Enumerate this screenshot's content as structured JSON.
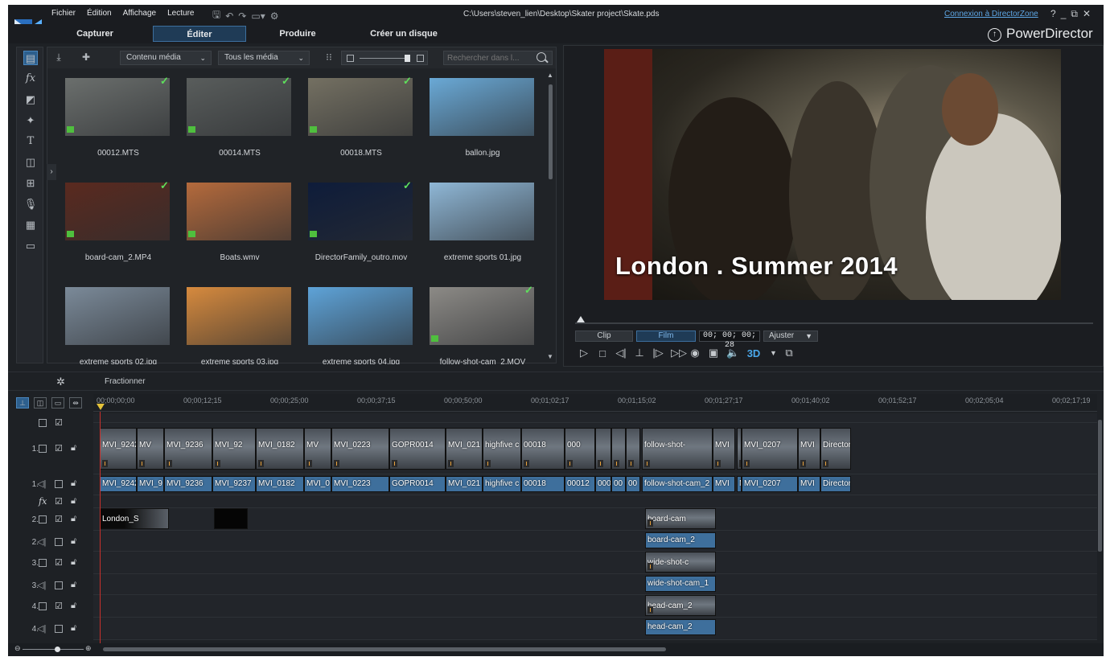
{
  "menu": [
    "Fichier",
    "Édition",
    "Affichage",
    "Lecture"
  ],
  "window": {
    "path": "C:\\Users\\steven_lien\\Desktop\\Skater project\\Skate.pds",
    "directorzone": "Connexion à DirectorZone",
    "brand": "PowerDirector"
  },
  "modes": [
    "Capturer",
    "Éditer",
    "Produire",
    "Créer un disque"
  ],
  "library": {
    "filter1": "Contenu média",
    "filter2": "Tous les média",
    "search_placeholder": "Rechercher dans l...",
    "items": [
      {
        "name": "00012.MTS",
        "checked": true,
        "video": true,
        "color": "#6b6f6d"
      },
      {
        "name": "00014.MTS",
        "checked": true,
        "video": true,
        "color": "#595d5c"
      },
      {
        "name": "00018.MTS",
        "checked": true,
        "video": true,
        "color": "#747062"
      },
      {
        "name": "ballon.jpg",
        "checked": false,
        "video": false,
        "color": "#6aa9d6"
      },
      {
        "name": "board-cam_2.MP4",
        "checked": true,
        "video": true,
        "color": "#5a2a1f"
      },
      {
        "name": "Boats.wmv",
        "checked": false,
        "video": true,
        "color": "#b46a3c"
      },
      {
        "name": "DirectorFamily_outro.mov",
        "checked": true,
        "video": true,
        "color": "#0e1c3a"
      },
      {
        "name": "extreme sports 01.jpg",
        "checked": false,
        "video": false,
        "color": "#8fb7d6"
      },
      {
        "name": "extreme sports 02.jpg",
        "checked": false,
        "video": false,
        "color": "#7b8a99"
      },
      {
        "name": "extreme sports 03.jpg",
        "checked": false,
        "video": false,
        "color": "#d68a3e"
      },
      {
        "name": "extreme sports 04.jpg",
        "checked": false,
        "video": false,
        "color": "#5ea3d8"
      },
      {
        "name": "follow-shot-cam_2.MOV",
        "checked": true,
        "video": true,
        "color": "#8c8a86"
      }
    ]
  },
  "preview": {
    "caption": "London . Summer 2014",
    "clip_label": "Clip",
    "film_label": "Film",
    "timecode": "00; 00; 00; 28",
    "fit_label": "Ajuster",
    "three_d": "3D"
  },
  "timeline": {
    "tool_label": "Fractionner",
    "ruler": [
      "00;00;00;00",
      "00;00;12;15",
      "00;00;25;00",
      "00;00;37;15",
      "00;00;50;00",
      "00;01;02;17",
      "00;01;15;02",
      "00;01;27;17",
      "00;01;40;02",
      "00;01;52;17",
      "00;02;05;04",
      "00;02;17;19"
    ],
    "tracks": [
      "1.",
      "1.",
      "2.",
      "2.",
      "3.",
      "3.",
      "4.",
      "4."
    ],
    "video1": [
      "MVI_9242",
      "MV",
      "MVI_9236",
      "MVI_92",
      "MVI_0182",
      "MV",
      "MVI_0223",
      "GOPR0014",
      "MVI_021",
      "highfive c",
      "00018",
      "000",
      "follow-shot-",
      "MVI",
      "MVI_0207",
      "MVI",
      "DirectorFa"
    ],
    "audio1": [
      "MVI_9242",
      "MVI_9",
      "MVI_9236",
      "MVI_9237",
      "MVI_0182",
      "MVI_0",
      "MVI_0223",
      "GOPR0014",
      "MVI_021",
      "highfive c",
      "00018",
      "00012",
      "000",
      "00",
      "00",
      "follow-shot-cam_2",
      "MVI",
      "M",
      "MVI_0207",
      "MVI",
      "Director"
    ],
    "title_clip": "London_S",
    "board_v": "board-cam",
    "board_a": "board-cam_2",
    "wide_v": "wide-shot-c",
    "wide_a": "wide-shot-cam_1",
    "head_v": "head-cam_2",
    "head_a": "head-cam_2"
  }
}
